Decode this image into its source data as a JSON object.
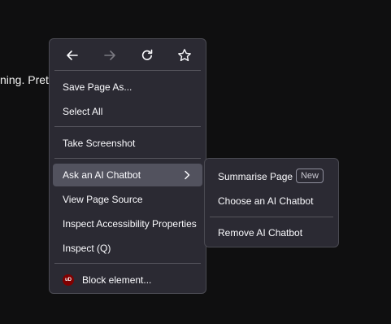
{
  "background": {
    "text": "ning. Pretty"
  },
  "nav": {
    "back_icon": "back-arrow-icon",
    "forward_icon": "forward-arrow-icon",
    "reload_icon": "reload-icon",
    "bookmark_icon": "star-icon"
  },
  "menu": {
    "save_page_as": "Save Page As...",
    "select_all": "Select All",
    "take_screenshot": "Take Screenshot",
    "ask_ai_chatbot": "Ask an AI Chatbot",
    "view_page_source": "View Page Source",
    "inspect_accessibility": "Inspect Accessibility Properties",
    "inspect": "Inspect (Q)",
    "block_element": "Block element...",
    "block_element_icon_text": "uD"
  },
  "submenu": {
    "summarise_page": "Summarise Page",
    "new_badge": "New",
    "choose_chatbot": "Choose an AI Chatbot",
    "remove_chatbot": "Remove AI Chatbot"
  },
  "colors": {
    "menu_bg": "#2b2a33",
    "active_bg": "#52525e",
    "text": "#fbfbfe",
    "page_bg": "#0f0f10"
  }
}
